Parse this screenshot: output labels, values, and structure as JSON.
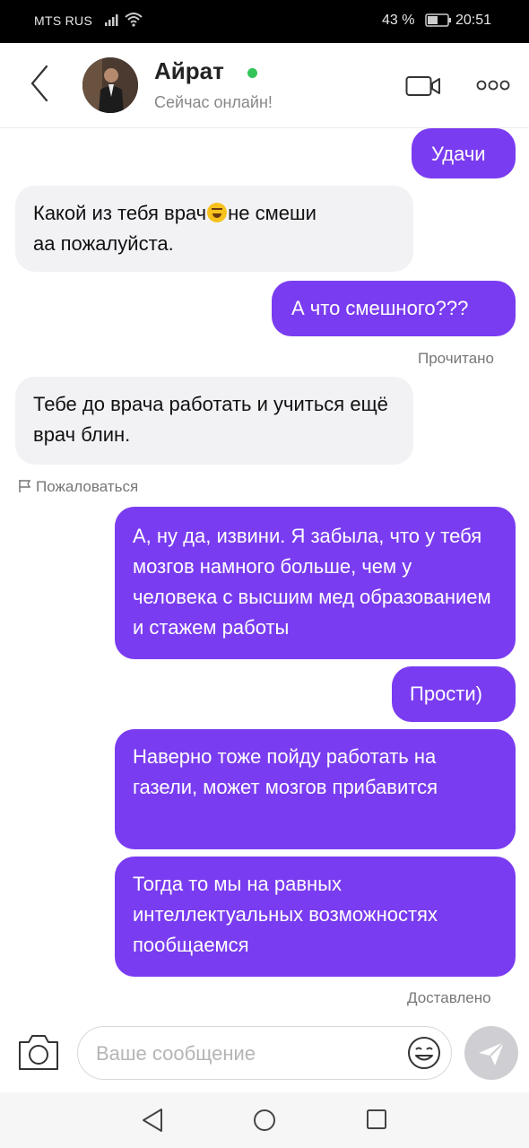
{
  "status_bar": {
    "carrier": "MTS RUS",
    "battery_percent": "43 %",
    "time": "20:51"
  },
  "header": {
    "contact_name": "Айрат",
    "contact_status": "Сейчас онлайн!",
    "online_color": "#33c55a"
  },
  "messages": [
    {
      "direction": "out",
      "text": "Удачи"
    },
    {
      "direction": "in",
      "text_before_emoji": "Какой из тебя врач",
      "emoji": "rofl-emoji",
      "text_after_emoji": "не смеши",
      "text_line2": "аа пожалуйста."
    },
    {
      "direction": "out",
      "text": "А что смешного???"
    },
    {
      "direction": "in",
      "text": "Тебе до врача работать и учиться ещё врач блин."
    },
    {
      "direction": "out",
      "text": "А, ну да, извини. Я забыла, что у тебя мозгов намного больше, чем у человека с высшим мед образованием и стажем работы"
    },
    {
      "direction": "out",
      "text": "Прости)"
    },
    {
      "direction": "out",
      "text": "Наверно тоже пойду работать на газели, может мозгов прибавится"
    },
    {
      "direction": "out",
      "text": "Тогда то мы на равных интеллектуальных возможностях пообщаемся"
    }
  ],
  "read_receipt": "Прочитано",
  "report_label": "Пожаловаться",
  "delivered_receipt": "Доставлено",
  "input": {
    "placeholder": "Ваше сообщение",
    "value": ""
  },
  "colors": {
    "outgoing_bubble": "#7a3cf0",
    "incoming_bubble": "#f2f2f5",
    "send_button": "#cfcfd3"
  },
  "icons": [
    "signal-icon",
    "wifi-icon",
    "battery-icon",
    "back-arrow-icon",
    "video-call-icon",
    "more-options-icon",
    "flag-icon",
    "camera-icon",
    "smile-icon",
    "send-icon",
    "nav-back-icon",
    "nav-home-icon",
    "nav-recent-icon"
  ]
}
